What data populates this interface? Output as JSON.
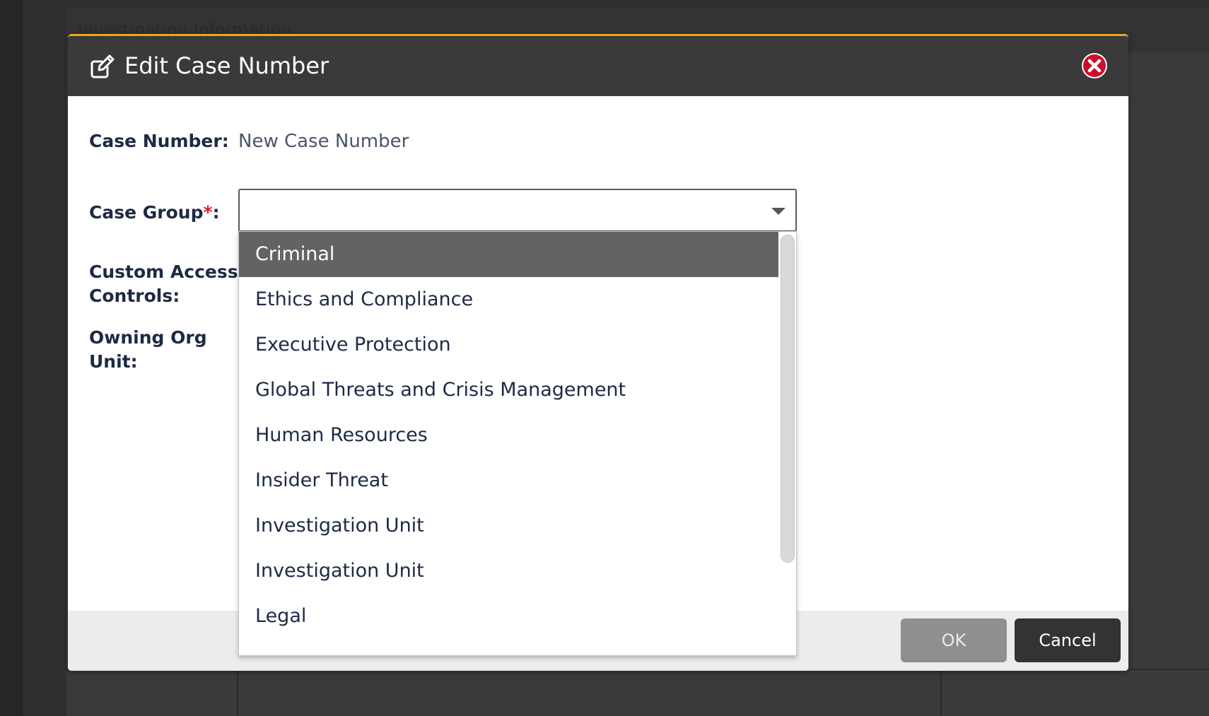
{
  "background": {
    "section_title": "Investigation Information"
  },
  "dialog": {
    "title": "Edit Case Number",
    "header_icon": "edit-icon",
    "close_icon": "close-icon",
    "accent_color": "#f0a21c"
  },
  "form": {
    "case_number_label": "Case Number:",
    "case_number_value": "New Case Number",
    "case_group_label": "Case Group",
    "case_group_required": "*",
    "case_group_suffix": ":",
    "case_group_value": "",
    "custom_access_label_line1": "Custom Access",
    "custom_access_label_line2": "Controls:",
    "owning_org_label_line1": "Owning Org",
    "owning_org_label_line2": "Unit:"
  },
  "dropdown": {
    "options": [
      "Criminal",
      "Ethics and Compliance",
      "Executive Protection",
      "Global Threats and Crisis Management",
      "Human Resources",
      "Insider Threat",
      "Investigation Unit",
      "Investigation Unit",
      "Legal"
    ],
    "highlighted": "Criminal"
  },
  "footer": {
    "ok_label": "OK",
    "cancel_label": "Cancel"
  }
}
